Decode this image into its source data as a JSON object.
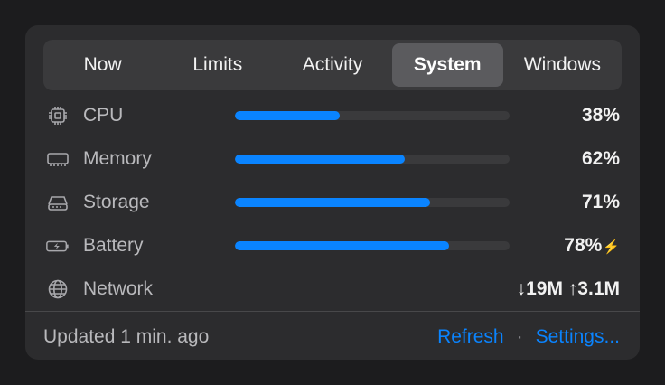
{
  "tabs": [
    {
      "label": "Now",
      "active": false
    },
    {
      "label": "Limits",
      "active": false
    },
    {
      "label": "Activity",
      "active": false
    },
    {
      "label": "System",
      "active": true
    },
    {
      "label": "Windows",
      "active": false
    }
  ],
  "rows": [
    {
      "label": "CPU",
      "icon": "cpu-icon",
      "percent": 38,
      "value": "38%"
    },
    {
      "label": "Memory",
      "icon": "memory-icon",
      "percent": 62,
      "value": "62%"
    },
    {
      "label": "Storage",
      "icon": "storage-icon",
      "percent": 71,
      "value": "71%"
    },
    {
      "label": "Battery",
      "icon": "battery-charging-icon",
      "percent": 78,
      "value": "78%",
      "charging_glyph": "⚡"
    },
    {
      "label": "Network",
      "icon": "globe-icon",
      "value": "↓19M ↑3.1M"
    }
  ],
  "footer": {
    "updated": "Updated 1 min. ago",
    "refresh_label": "Refresh",
    "separator": "·",
    "settings_label": "Settings..."
  },
  "colors": {
    "accent": "#0a84ff",
    "panel": "#2c2c2e",
    "track": "#3a3a3c"
  }
}
